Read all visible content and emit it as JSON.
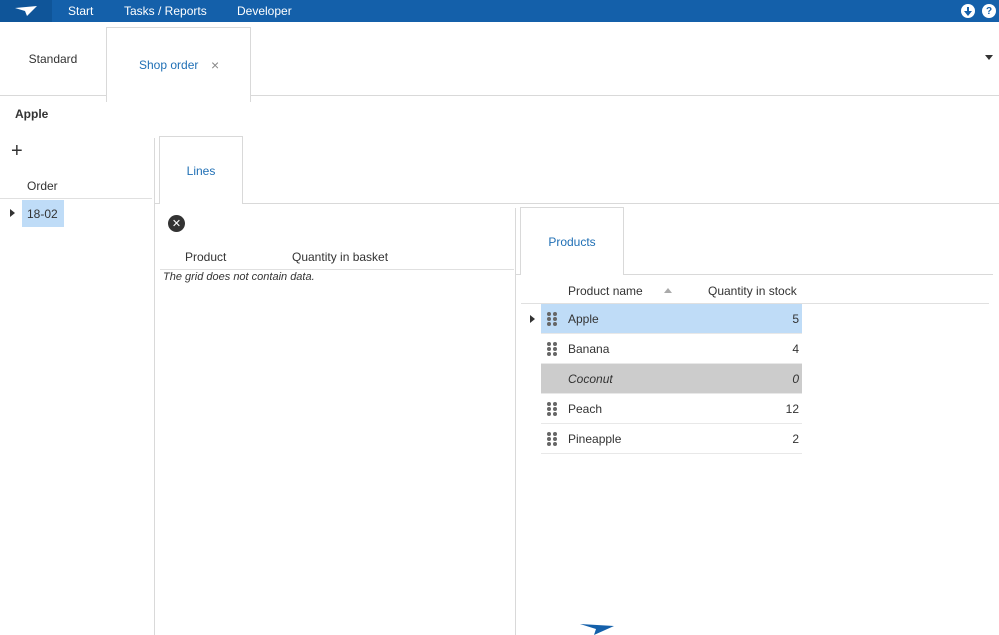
{
  "topbar": {
    "menu": [
      "Start",
      "Tasks / Reports",
      "Developer"
    ],
    "help_label": "?"
  },
  "tabs": {
    "standard": "Standard",
    "shop_order": "Shop order",
    "close_glyph": "×"
  },
  "record": {
    "title": "Apple"
  },
  "orders": {
    "add_glyph": "+",
    "header": "Order",
    "rows": [
      "18-02"
    ]
  },
  "lines": {
    "tab_label": "Lines",
    "delete_glyph": "✕",
    "columns": [
      "Product",
      "Quantity in basket"
    ],
    "empty_message": "The grid does not contain data."
  },
  "products": {
    "tab_label": "Products",
    "columns": [
      "Product name",
      "Quantity in stock"
    ],
    "rows": [
      {
        "name": "Apple",
        "qty": "5"
      },
      {
        "name": "Banana",
        "qty": "4"
      },
      {
        "name": "Coconut",
        "qty": "0"
      },
      {
        "name": "Peach",
        "qty": "12"
      },
      {
        "name": "Pineapple",
        "qty": "2"
      }
    ]
  },
  "colors": {
    "topbar": "#1460aa",
    "link": "#1f6fb5",
    "selected_row": "#bfdcf7",
    "disabled_row": "#cccccc"
  }
}
